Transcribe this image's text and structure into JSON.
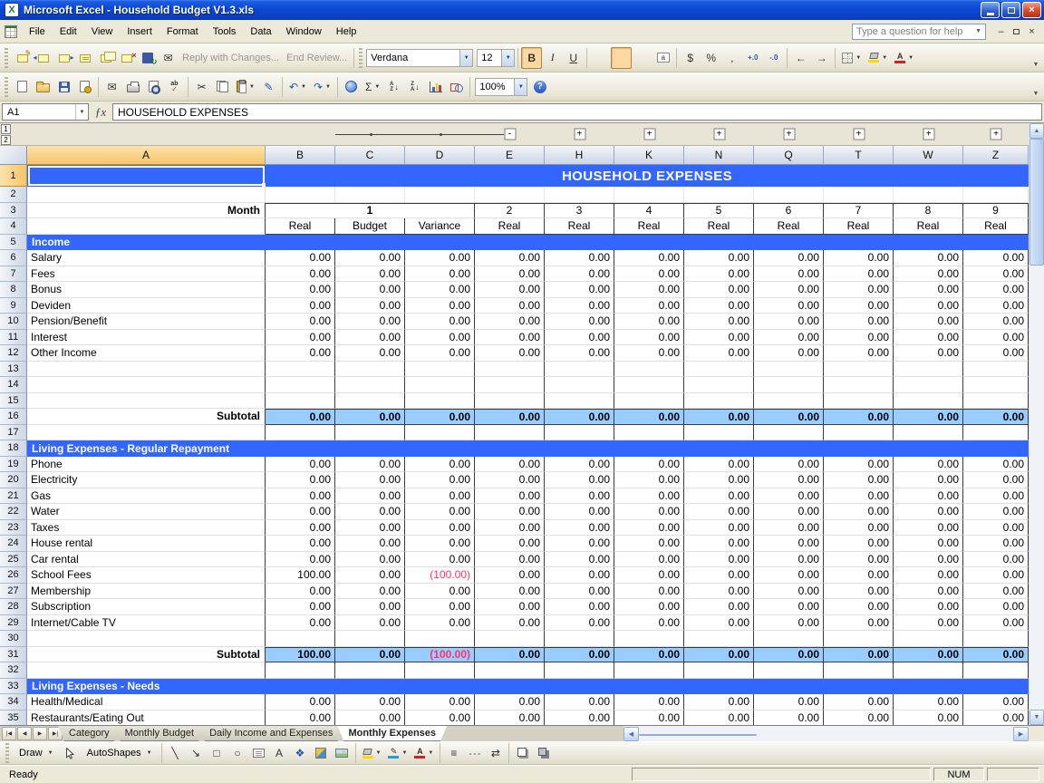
{
  "accent_colors": {
    "section_blue": "#3366FF",
    "subtotal_blue": "#99CCFF",
    "negative_red": "#FF3366"
  },
  "titlebar": {
    "title": "Microsoft Excel - Household Budget V1.3.xls"
  },
  "menubar": {
    "items": [
      "File",
      "Edit",
      "View",
      "Insert",
      "Format",
      "Tools",
      "Data",
      "Window",
      "Help"
    ],
    "ask_box_placeholder": "Type a question for help"
  },
  "reviewing_toolbar": {
    "reply_with_changes": "Reply with Changes...",
    "end_review": "End Review...",
    "icons": [
      {
        "name": "edit-comment-icon",
        "kind": "note-edit"
      },
      {
        "name": "previous-comment-icon",
        "kind": "note-prev"
      },
      {
        "name": "next-comment-icon",
        "kind": "note-next"
      },
      {
        "name": "show-comment-icon",
        "kind": "note-show"
      },
      {
        "name": "show-all-comments-icon",
        "kind": "note-all"
      },
      {
        "name": "delete-comment-icon",
        "kind": "note-del"
      },
      {
        "name": "update-file-icon",
        "kind": "update-file"
      },
      {
        "name": "send-to-mail-recipient-icon",
        "kind": "mail"
      }
    ]
  },
  "formatting_toolbar": {
    "font_name": "Verdana",
    "font_size": "12",
    "icons": [
      {
        "name": "bold-button",
        "kind": "bold",
        "pressed": true
      },
      {
        "name": "italic-button",
        "kind": "italic"
      },
      {
        "name": "underline-button",
        "kind": "underline"
      },
      {
        "sep": true
      },
      {
        "name": "align-left-button",
        "kind": "align-left"
      },
      {
        "name": "align-center-button",
        "kind": "align-center",
        "pressed": true
      },
      {
        "name": "align-right-button",
        "kind": "align-right"
      },
      {
        "name": "merge-and-center-button",
        "kind": "merge"
      },
      {
        "sep": true
      },
      {
        "name": "currency-style-button",
        "kind": "currency"
      },
      {
        "name": "percent-style-button",
        "kind": "percent"
      },
      {
        "name": "comma-style-button",
        "kind": "comma"
      },
      {
        "name": "increase-decimal-button",
        "kind": "increase-decimal"
      },
      {
        "name": "decrease-decimal-button",
        "kind": "decrease-decimal"
      },
      {
        "sep": true
      },
      {
        "name": "decrease-indent-button",
        "kind": "decrease-indent"
      },
      {
        "name": "increase-indent-button",
        "kind": "increase-indent"
      },
      {
        "sep": true
      },
      {
        "name": "borders-button",
        "kind": "borders",
        "dropdown": true
      },
      {
        "name": "fill-color-button",
        "kind": "fill-color",
        "dropdown": true
      },
      {
        "name": "font-color-button",
        "kind": "font-color",
        "dropdown": true
      }
    ]
  },
  "standard_toolbar": {
    "zoom": "100%",
    "icons": [
      {
        "name": "new-workbook-button",
        "kind": "page"
      },
      {
        "name": "open-button",
        "kind": "folder"
      },
      {
        "name": "save-button",
        "kind": "disk"
      },
      {
        "name": "permission-button",
        "kind": "perm"
      },
      {
        "sep": true
      },
      {
        "name": "email-button",
        "kind": "mail"
      },
      {
        "name": "print-button",
        "kind": "printer"
      },
      {
        "name": "print-preview-button",
        "kind": "preview"
      },
      {
        "name": "spelling-button",
        "kind": "spell"
      },
      {
        "sep": true
      },
      {
        "name": "cut-button",
        "kind": "cut"
      },
      {
        "name": "copy-button",
        "kind": "copy"
      },
      {
        "name": "paste-button",
        "kind": "paste",
        "dropdown": true
      },
      {
        "name": "format-painter-button",
        "kind": "painter"
      },
      {
        "sep": true
      },
      {
        "name": "undo-button",
        "kind": "undo",
        "dropdown": true
      },
      {
        "name": "redo-button",
        "kind": "redo",
        "dropdown": true
      },
      {
        "sep": true
      },
      {
        "name": "insert-hyperlink-button",
        "kind": "link"
      },
      {
        "name": "autosum-button",
        "kind": "sum",
        "dropdown": true
      },
      {
        "name": "sort-ascending-button",
        "kind": "sort-az"
      },
      {
        "name": "sort-descending-button",
        "kind": "sort-za"
      },
      {
        "name": "chart-wizard-button",
        "kind": "chart"
      },
      {
        "name": "drawing-button",
        "kind": "drawing"
      },
      {
        "sep": true
      },
      {
        "name": "zoom-combo",
        "kind": "zoom"
      },
      {
        "name": "help-button",
        "kind": "help"
      }
    ]
  },
  "formula_bar": {
    "name_box": "A1",
    "formula": "HOUSEHOLD EXPENSES"
  },
  "sheet": {
    "title": "HOUSEHOLD EXPENSES",
    "columns": [
      "A",
      "B",
      "C",
      "D",
      "E",
      "H",
      "K",
      "N",
      "Q",
      "T",
      "W",
      "Z"
    ],
    "outline": {
      "levels": [
        "1",
        "2"
      ],
      "expanded_group": [
        "C",
        "D"
      ],
      "collapse_at": "E",
      "expand_at": [
        "H",
        "K",
        "N",
        "Q",
        "T",
        "W",
        "Z"
      ]
    },
    "rows": [
      {
        "n": "1",
        "type": "title"
      },
      {
        "n": "2",
        "type": "outside-blank"
      },
      {
        "n": "3",
        "type": "month",
        "label": "Month",
        "merged_value": "1",
        "values": [
          "2",
          "3",
          "4",
          "5",
          "6",
          "7",
          "8",
          "9"
        ]
      },
      {
        "n": "4",
        "type": "subheader",
        "values": [
          "Real",
          "Budget",
          "Variance",
          "Real",
          "Real",
          "Real",
          "Real",
          "Real",
          "Real",
          "Real",
          "Real"
        ]
      },
      {
        "n": "5",
        "type": "section",
        "label": "Income"
      },
      {
        "n": "6",
        "type": "data",
        "label": "Salary",
        "values": [
          "0.00",
          "0.00",
          "0.00",
          "0.00",
          "0.00",
          "0.00",
          "0.00",
          "0.00",
          "0.00",
          "0.00",
          "0.00"
        ]
      },
      {
        "n": "7",
        "type": "data",
        "label": "Fees",
        "values": [
          "0.00",
          "0.00",
          "0.00",
          "0.00",
          "0.00",
          "0.00",
          "0.00",
          "0.00",
          "0.00",
          "0.00",
          "0.00"
        ]
      },
      {
        "n": "8",
        "type": "data",
        "label": "Bonus",
        "values": [
          "0.00",
          "0.00",
          "0.00",
          "0.00",
          "0.00",
          "0.00",
          "0.00",
          "0.00",
          "0.00",
          "0.00",
          "0.00"
        ]
      },
      {
        "n": "9",
        "type": "data",
        "label": "Deviden",
        "values": [
          "0.00",
          "0.00",
          "0.00",
          "0.00",
          "0.00",
          "0.00",
          "0.00",
          "0.00",
          "0.00",
          "0.00",
          "0.00"
        ]
      },
      {
        "n": "10",
        "type": "data",
        "label": "Pension/Benefit",
        "values": [
          "0.00",
          "0.00",
          "0.00",
          "0.00",
          "0.00",
          "0.00",
          "0.00",
          "0.00",
          "0.00",
          "0.00",
          "0.00"
        ]
      },
      {
        "n": "11",
        "type": "data",
        "label": "Interest",
        "values": [
          "0.00",
          "0.00",
          "0.00",
          "0.00",
          "0.00",
          "0.00",
          "0.00",
          "0.00",
          "0.00",
          "0.00",
          "0.00"
        ]
      },
      {
        "n": "12",
        "type": "data",
        "label": "Other Income",
        "values": [
          "0.00",
          "0.00",
          "0.00",
          "0.00",
          "0.00",
          "0.00",
          "0.00",
          "0.00",
          "0.00",
          "0.00",
          "0.00"
        ]
      },
      {
        "n": "13",
        "type": "blank"
      },
      {
        "n": "14",
        "type": "blank"
      },
      {
        "n": "15",
        "type": "blank"
      },
      {
        "n": "16",
        "type": "subtotal",
        "label": "Subtotal",
        "values": [
          "0.00",
          "0.00",
          "0.00",
          "0.00",
          "0.00",
          "0.00",
          "0.00",
          "0.00",
          "0.00",
          "0.00",
          "0.00"
        ]
      },
      {
        "n": "17",
        "type": "blank"
      },
      {
        "n": "18",
        "type": "section",
        "label": "Living Expenses - Regular Repayment"
      },
      {
        "n": "19",
        "type": "data",
        "label": "Phone",
        "values": [
          "0.00",
          "0.00",
          "0.00",
          "0.00",
          "0.00",
          "0.00",
          "0.00",
          "0.00",
          "0.00",
          "0.00",
          "0.00"
        ]
      },
      {
        "n": "20",
        "type": "data",
        "label": "Electricity",
        "values": [
          "0.00",
          "0.00",
          "0.00",
          "0.00",
          "0.00",
          "0.00",
          "0.00",
          "0.00",
          "0.00",
          "0.00",
          "0.00"
        ]
      },
      {
        "n": "21",
        "type": "data",
        "label": "Gas",
        "values": [
          "0.00",
          "0.00",
          "0.00",
          "0.00",
          "0.00",
          "0.00",
          "0.00",
          "0.00",
          "0.00",
          "0.00",
          "0.00"
        ]
      },
      {
        "n": "22",
        "type": "data",
        "label": "Water",
        "values": [
          "0.00",
          "0.00",
          "0.00",
          "0.00",
          "0.00",
          "0.00",
          "0.00",
          "0.00",
          "0.00",
          "0.00",
          "0.00"
        ]
      },
      {
        "n": "23",
        "type": "data",
        "label": "Taxes",
        "values": [
          "0.00",
          "0.00",
          "0.00",
          "0.00",
          "0.00",
          "0.00",
          "0.00",
          "0.00",
          "0.00",
          "0.00",
          "0.00"
        ]
      },
      {
        "n": "24",
        "type": "data",
        "label": "House rental",
        "values": [
          "0.00",
          "0.00",
          "0.00",
          "0.00",
          "0.00",
          "0.00",
          "0.00",
          "0.00",
          "0.00",
          "0.00",
          "0.00"
        ]
      },
      {
        "n": "25",
        "type": "data",
        "label": "Car rental",
        "values": [
          "0.00",
          "0.00",
          "0.00",
          "0.00",
          "0.00",
          "0.00",
          "0.00",
          "0.00",
          "0.00",
          "0.00",
          "0.00"
        ]
      },
      {
        "n": "26",
        "type": "data",
        "label": "School Fees",
        "values": [
          "100.00",
          "0.00",
          "(100.00)",
          "0.00",
          "0.00",
          "0.00",
          "0.00",
          "0.00",
          "0.00",
          "0.00",
          "0.00"
        ]
      },
      {
        "n": "27",
        "type": "data",
        "label": "Membership",
        "values": [
          "0.00",
          "0.00",
          "0.00",
          "0.00",
          "0.00",
          "0.00",
          "0.00",
          "0.00",
          "0.00",
          "0.00",
          "0.00"
        ]
      },
      {
        "n": "28",
        "type": "data",
        "label": "Subscription",
        "values": [
          "0.00",
          "0.00",
          "0.00",
          "0.00",
          "0.00",
          "0.00",
          "0.00",
          "0.00",
          "0.00",
          "0.00",
          "0.00"
        ]
      },
      {
        "n": "29",
        "type": "data",
        "label": "Internet/Cable TV",
        "values": [
          "0.00",
          "0.00",
          "0.00",
          "0.00",
          "0.00",
          "0.00",
          "0.00",
          "0.00",
          "0.00",
          "0.00",
          "0.00"
        ]
      },
      {
        "n": "30",
        "type": "blank"
      },
      {
        "n": "31",
        "type": "subtotal",
        "label": "Subtotal",
        "values": [
          "100.00",
          "0.00",
          "(100.00)",
          "0.00",
          "0.00",
          "0.00",
          "0.00",
          "0.00",
          "0.00",
          "0.00",
          "0.00"
        ]
      },
      {
        "n": "32",
        "type": "blank"
      },
      {
        "n": "33",
        "type": "section",
        "label": "Living Expenses - Needs"
      },
      {
        "n": "34",
        "type": "data",
        "label": "Health/Medical",
        "values": [
          "0.00",
          "0.00",
          "0.00",
          "0.00",
          "0.00",
          "0.00",
          "0.00",
          "0.00",
          "0.00",
          "0.00",
          "0.00"
        ]
      },
      {
        "n": "35",
        "type": "data",
        "label": "Restaurants/Eating Out",
        "values": [
          "0.00",
          "0.00",
          "0.00",
          "0.00",
          "0.00",
          "0.00",
          "0.00",
          "0.00",
          "0.00",
          "0.00",
          "0.00"
        ]
      }
    ]
  },
  "sheet_tabs": {
    "tabs": [
      "Category",
      "Monthly Budget",
      "Daily Income and Expenses",
      "Monthly Expenses"
    ],
    "active": "Monthly Expenses"
  },
  "drawing_toolbar": {
    "draw_label": "Draw",
    "autoshapes_label": "AutoShapes",
    "icons": [
      {
        "name": "line-button",
        "kind": "line"
      },
      {
        "name": "arrow-button",
        "kind": "arrow"
      },
      {
        "name": "rectangle-button",
        "kind": "rect"
      },
      {
        "name": "oval-button",
        "kind": "oval"
      },
      {
        "name": "text-box-button",
        "kind": "textbox"
      },
      {
        "name": "insert-wordart-button",
        "kind": "wordart"
      },
      {
        "name": "insert-diagram-button",
        "kind": "diagram"
      },
      {
        "name": "insert-clipart-button",
        "kind": "clipart"
      },
      {
        "name": "insert-picture-button",
        "kind": "picture"
      },
      {
        "sep": true
      },
      {
        "name": "draw-fill-color-button",
        "kind": "fill-color",
        "dropdown": true
      },
      {
        "name": "draw-line-color-button",
        "kind": "line-color",
        "dropdown": true
      },
      {
        "name": "draw-font-color-button",
        "kind": "font-color2",
        "dropdown": true
      },
      {
        "sep": true
      },
      {
        "name": "line-style-button",
        "kind": "line-style"
      },
      {
        "name": "dash-style-button",
        "kind": "dash-style"
      },
      {
        "name": "arrow-style-button",
        "kind": "arrow-style"
      },
      {
        "sep": true
      },
      {
        "name": "shadow-style-button",
        "kind": "shadow"
      },
      {
        "name": "3d-style-button",
        "kind": "threed"
      }
    ]
  },
  "status_bar": {
    "mode": "Ready",
    "num_lock": "NUM"
  }
}
